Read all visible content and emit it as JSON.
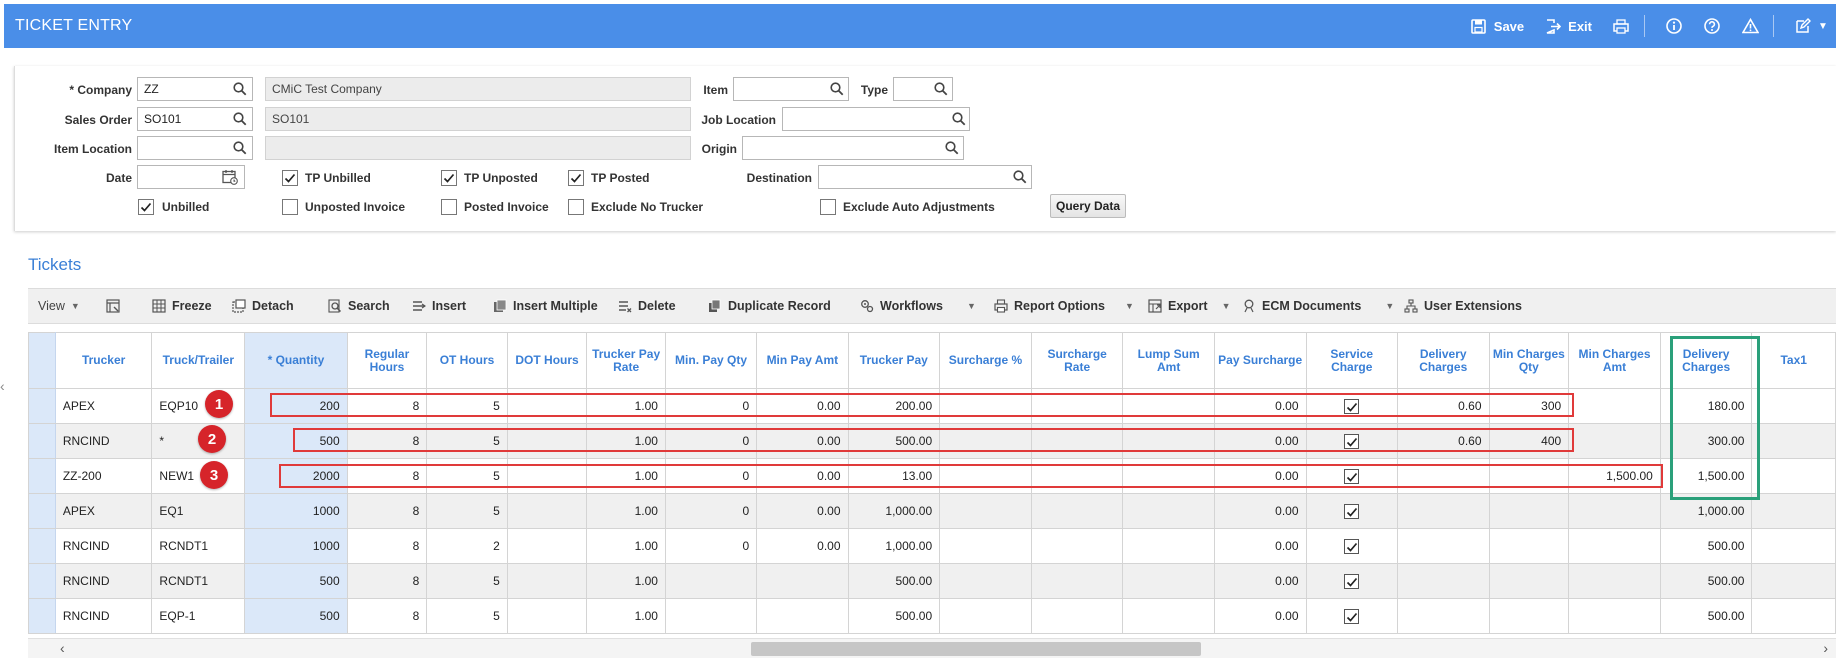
{
  "header": {
    "title": "TICKET ENTRY",
    "save_label": "Save",
    "exit_label": "Exit"
  },
  "filter": {
    "company_label": "* Company",
    "company_value": "ZZ",
    "company_name": "CMiC Test Company",
    "sales_order_label": "Sales Order",
    "sales_order_value": "SO101",
    "sales_order_name": "SO101",
    "item_location_label": "Item Location",
    "item_location_value": "",
    "date_label": "Date",
    "date_value": "",
    "item_label": "Item",
    "item_value": "",
    "type_label": "Type",
    "type_value": "",
    "job_location_label": "Job Location",
    "job_location_value": "",
    "origin_label": "Origin",
    "origin_value": "",
    "destination_label": "Destination",
    "destination_value": "",
    "checkboxes": {
      "tp_unbilled": {
        "label": "TP Unbilled",
        "checked": true
      },
      "tp_unposted": {
        "label": "TP Unposted",
        "checked": true
      },
      "tp_posted": {
        "label": "TP Posted",
        "checked": true
      },
      "unbilled": {
        "label": "Unbilled",
        "checked": true
      },
      "unposted_invoice": {
        "label": "Unposted Invoice",
        "checked": false
      },
      "posted_invoice": {
        "label": "Posted Invoice",
        "checked": false
      },
      "exclude_no_trucker": {
        "label": "Exclude No Trucker",
        "checked": false
      },
      "exclude_auto_adjustments": {
        "label": "Exclude Auto Adjustments",
        "checked": false
      }
    },
    "query_button": "Query Data"
  },
  "tickets": {
    "title": "Tickets",
    "toolbar": {
      "view": "View",
      "freeze": "Freeze",
      "detach": "Detach",
      "search": "Search",
      "insert": "Insert",
      "insert_multiple": "Insert Multiple",
      "delete": "Delete",
      "duplicate_record": "Duplicate Record",
      "workflows": "Workflows",
      "report_options": "Report Options",
      "export": "Export",
      "ecm_documents": "ECM Documents",
      "user_extensions": "User Extensions"
    },
    "columns": [
      "Trucker",
      "Truck/Trailer",
      "* Quantity",
      "Regular Hours",
      "OT Hours",
      "DOT Hours",
      "Trucker Pay Rate",
      "Min. Pay Qty",
      "Min Pay Amt",
      "Trucker Pay",
      "Surcharge %",
      "Surcharge Rate",
      "Lump Sum Amt",
      "Pay Surcharge",
      "Service Charge",
      "Delivery Charges",
      "Min Charges Qty",
      "Min Charges Amt",
      "Delivery Charges",
      "Tax1"
    ],
    "rows": [
      [
        "APEX",
        "EQP10",
        "200",
        "8",
        "5",
        "",
        "1.00",
        "0",
        "0.00",
        "200.00",
        "",
        "",
        "",
        "0.00",
        "check",
        "0.60",
        "300",
        "",
        "180.00",
        ""
      ],
      [
        "RNCIND",
        "*",
        "500",
        "8",
        "5",
        "",
        "1.00",
        "0",
        "0.00",
        "500.00",
        "",
        "",
        "",
        "0.00",
        "check",
        "0.60",
        "400",
        "",
        "300.00",
        ""
      ],
      [
        "ZZ-200",
        "NEW1",
        "2000",
        "8",
        "5",
        "",
        "1.00",
        "0",
        "0.00",
        "13.00",
        "",
        "",
        "",
        "0.00",
        "check",
        "",
        "",
        "1,500.00",
        "1,500.00",
        ""
      ],
      [
        "APEX",
        "EQ1",
        "1000",
        "8",
        "5",
        "",
        "1.00",
        "0",
        "0.00",
        "1,000.00",
        "",
        "",
        "",
        "0.00",
        "check",
        "",
        "",
        "",
        "1,000.00",
        ""
      ],
      [
        "RNCIND",
        "RCNDT1",
        "1000",
        "8",
        "2",
        "",
        "1.00",
        "0",
        "0.00",
        "1,000.00",
        "",
        "",
        "",
        "0.00",
        "check",
        "",
        "",
        "",
        "500.00",
        ""
      ],
      [
        "RNCIND",
        "RCNDT1",
        "500",
        "8",
        "5",
        "",
        "1.00",
        "",
        "",
        "500.00",
        "",
        "",
        "",
        "0.00",
        "check",
        "",
        "",
        "",
        "500.00",
        ""
      ],
      [
        "RNCIND",
        "EQP-1",
        "500",
        "8",
        "5",
        "",
        "1.00",
        "",
        "",
        "500.00",
        "",
        "",
        "",
        "0.00",
        "check",
        "",
        "",
        "",
        "500.00",
        ""
      ]
    ],
    "badges": [
      "1",
      "2",
      "3"
    ]
  }
}
